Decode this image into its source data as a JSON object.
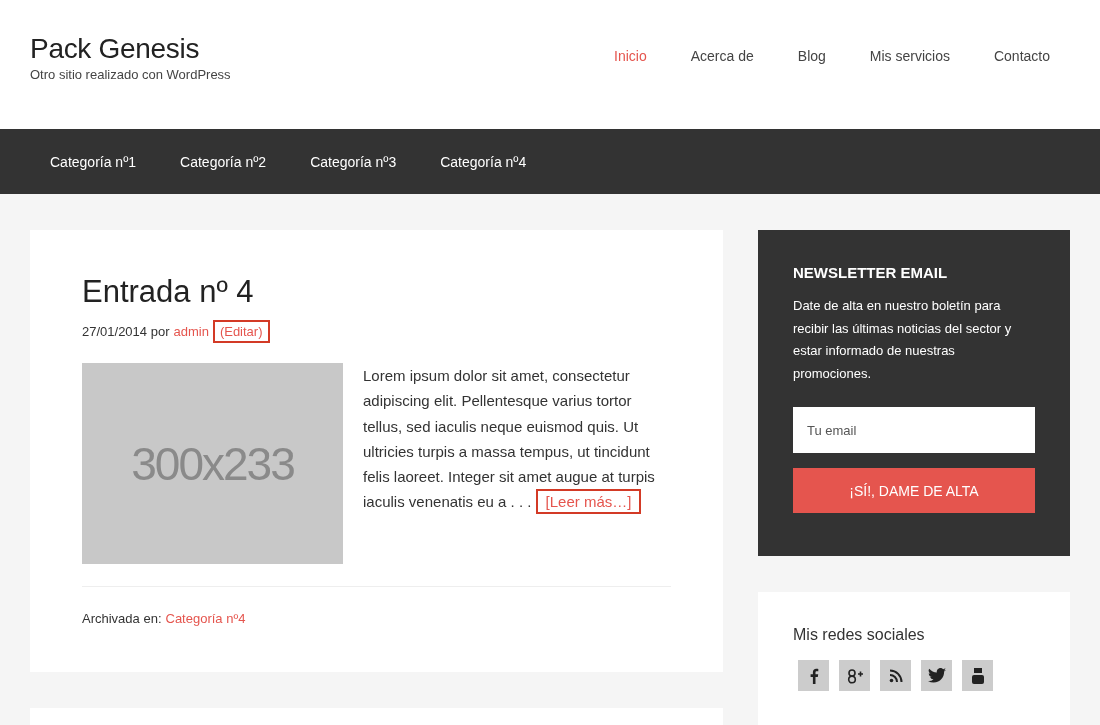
{
  "site": {
    "title": "Pack Genesis",
    "tagline": "Otro sitio realizado con WordPress"
  },
  "menu": [
    {
      "label": "Inicio",
      "selected": true
    },
    {
      "label": "Acerca de",
      "selected": false
    },
    {
      "label": "Blog",
      "selected": false
    },
    {
      "label": "Mis servicios",
      "selected": false
    },
    {
      "label": "Contacto",
      "selected": false
    }
  ],
  "categories": [
    "Categoría nº1",
    "Categoría nº2",
    "Categoría nº3",
    "Categoría nº4"
  ],
  "post": {
    "title": "Entrada nº 4",
    "date": "27/01/2014",
    "by": "por",
    "author": "admin",
    "edit": "(Editar)",
    "image_label": "300x233",
    "excerpt": "Lorem ipsum dolor sit amet, consectetur adipiscing elit. Pellentesque varius tortor tellus, sed iaculis neque euismod quis. Ut ultricies turpis a massa tempus, ut tincidunt felis laoreet. Integer sit amet augue at turpis iaculis venenatis eu a . . .",
    "read_more": "[Leer más…]",
    "filed_label": "Archivada en:",
    "filed_category": "Categoría nº4"
  },
  "newsletter": {
    "title": "NEWSLETTER EMAIL",
    "text": "Date de alta en nuestro boletín para recibir las últimas noticias del sector y estar informado de nuestras promociones.",
    "placeholder": "Tu email",
    "button": "¡SÍ!, DAME DE ALTA"
  },
  "social": {
    "title": "Mis redes sociales",
    "icons": [
      {
        "kind": "facebook"
      },
      {
        "kind": "googleplus"
      },
      {
        "kind": "rss"
      },
      {
        "kind": "twitter"
      },
      {
        "kind": "youtube"
      }
    ]
  }
}
